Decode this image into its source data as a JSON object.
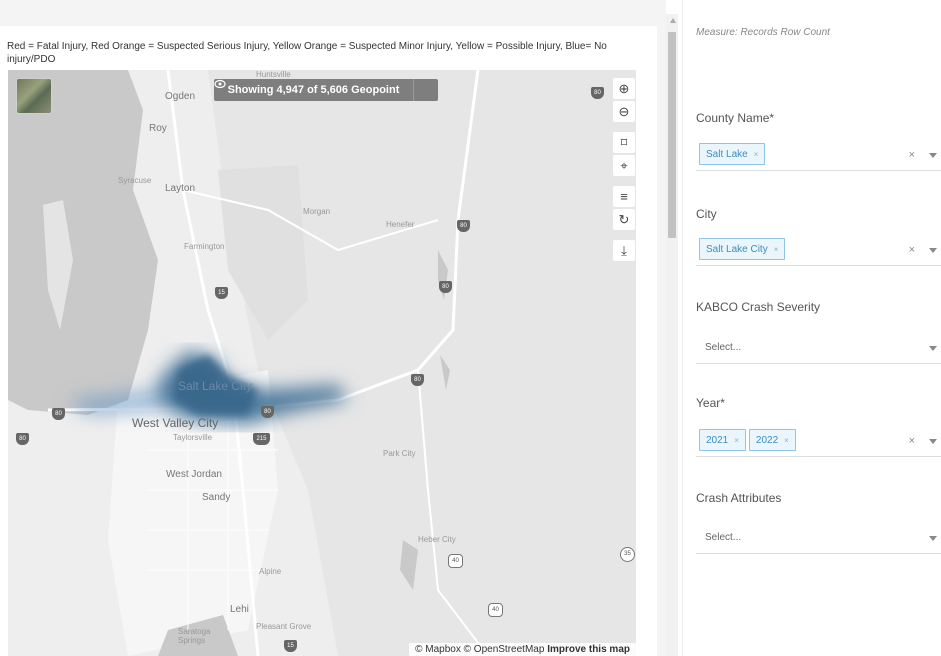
{
  "map_panel": {
    "legend_caption": "Red = Fatal Injury, Red Orange = Suspected Serious Injury, Yellow Orange = Suspected Minor Injury, Yellow = Possible Injury, Blue= No injury/PDO",
    "geopoint_banner": "Showing 4,947 of 5,606 Geopoint",
    "toolbar": {
      "zoom_in": "⊕",
      "zoom_out": "⊖",
      "select": "⌑",
      "locate": "⌖",
      "filter": "≡",
      "reset": "↻",
      "download": "⤓"
    },
    "places": [
      {
        "id": "huntsville",
        "label": "Huntsville"
      },
      {
        "id": "ogden",
        "label": "Ogden"
      },
      {
        "id": "roy",
        "label": "Roy"
      },
      {
        "id": "syracuse",
        "label": "Syracuse"
      },
      {
        "id": "layton",
        "label": "Layton"
      },
      {
        "id": "morgan",
        "label": "Morgan"
      },
      {
        "id": "henefer",
        "label": "Henefer"
      },
      {
        "id": "farmington",
        "label": "Farmington"
      },
      {
        "id": "salt-lake-city",
        "label": "Salt Lake City"
      },
      {
        "id": "west-valley-city",
        "label": "West Valley City"
      },
      {
        "id": "taylorsville",
        "label": "Taylorsville"
      },
      {
        "id": "park-city",
        "label": "Park City"
      },
      {
        "id": "west-jordan",
        "label": "West Jordan"
      },
      {
        "id": "sandy",
        "label": "Sandy"
      },
      {
        "id": "heber-city",
        "label": "Heber City"
      },
      {
        "id": "alpine",
        "label": "Alpine"
      },
      {
        "id": "lehi",
        "label": "Lehi"
      },
      {
        "id": "pleasant-grove",
        "label": "Pleasant Grove"
      },
      {
        "id": "saratoga-springs",
        "label": "Saratoga Springs"
      }
    ],
    "route_shields": [
      {
        "id": "i80-ne",
        "label": "80"
      },
      {
        "id": "i80-henefer",
        "label": "80"
      },
      {
        "id": "i80-echo",
        "label": "80"
      },
      {
        "id": "i15-north",
        "label": "15"
      },
      {
        "id": "i80-parleys",
        "label": "80"
      },
      {
        "id": "i80-west",
        "label": "80"
      },
      {
        "id": "i80-far-west",
        "label": "80"
      },
      {
        "id": "i215",
        "label": "215"
      },
      {
        "id": "i80-slc",
        "label": "80"
      },
      {
        "id": "us40-heber",
        "label": "40"
      },
      {
        "id": "us40-south",
        "label": "40"
      },
      {
        "id": "sr35",
        "label": "35"
      },
      {
        "id": "i15-south",
        "label": "15"
      }
    ],
    "attribution": {
      "mapbox": "© Mapbox",
      "osm": "© OpenStreetMap",
      "improve": "Improve this map"
    }
  },
  "filters_panel": {
    "measure": "Measure: Records Row Count",
    "county": {
      "label": "County Name*",
      "chips": [
        "Salt Lake"
      ],
      "clear": "×"
    },
    "city": {
      "label": "City",
      "chips": [
        "Salt Lake City"
      ],
      "clear": "×"
    },
    "kabco": {
      "label": "KABCO Crash Severity",
      "placeholder": "Select..."
    },
    "year": {
      "label": "Year*",
      "chips": [
        "2021",
        "2022"
      ],
      "clear": "×"
    },
    "crash_attributes": {
      "label": "Crash Attributes",
      "placeholder": "Select..."
    }
  },
  "colors": {
    "heat": "#3f6f94",
    "chip_border": "#8ec6e6",
    "chip_text": "#3b8ec2",
    "water": "#c9c9c9"
  }
}
